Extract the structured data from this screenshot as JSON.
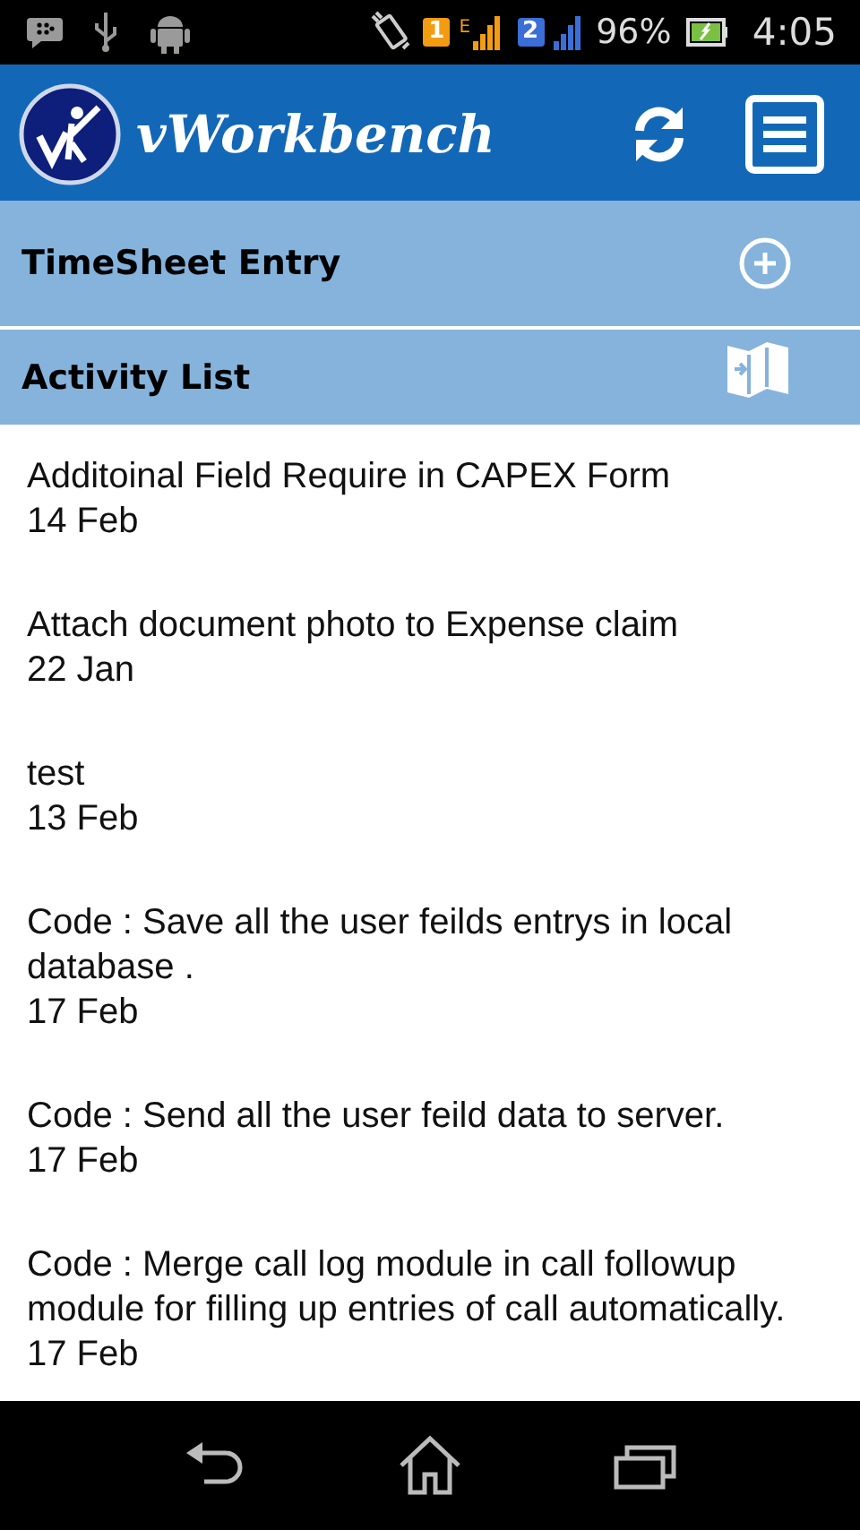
{
  "status_bar": {
    "sim1": "1",
    "network": "E",
    "sim2": "2",
    "battery": "96%",
    "time": "4:05"
  },
  "app_bar": {
    "title": "vWorkbench"
  },
  "sections": [
    {
      "title": "TimeSheet Entry",
      "kind": "add"
    },
    {
      "title": "Activity List",
      "kind": "book"
    }
  ],
  "activities": [
    {
      "title": "Additoinal Field Require in CAPEX Form",
      "date": "14 Feb"
    },
    {
      "title": "Attach document photo to Expense claim",
      "date": "22 Jan"
    },
    {
      "title": "test",
      "date": "13 Feb"
    },
    {
      "title": "Code : Save all the user feilds entrys in local database .",
      "date": "17 Feb"
    },
    {
      "title": "Code : Send all the user feild data to server.",
      "date": "17 Feb"
    },
    {
      "title": "Code : Merge call log module in call followup module for filling up entries of call automatically.",
      "date": "17 Feb"
    }
  ]
}
